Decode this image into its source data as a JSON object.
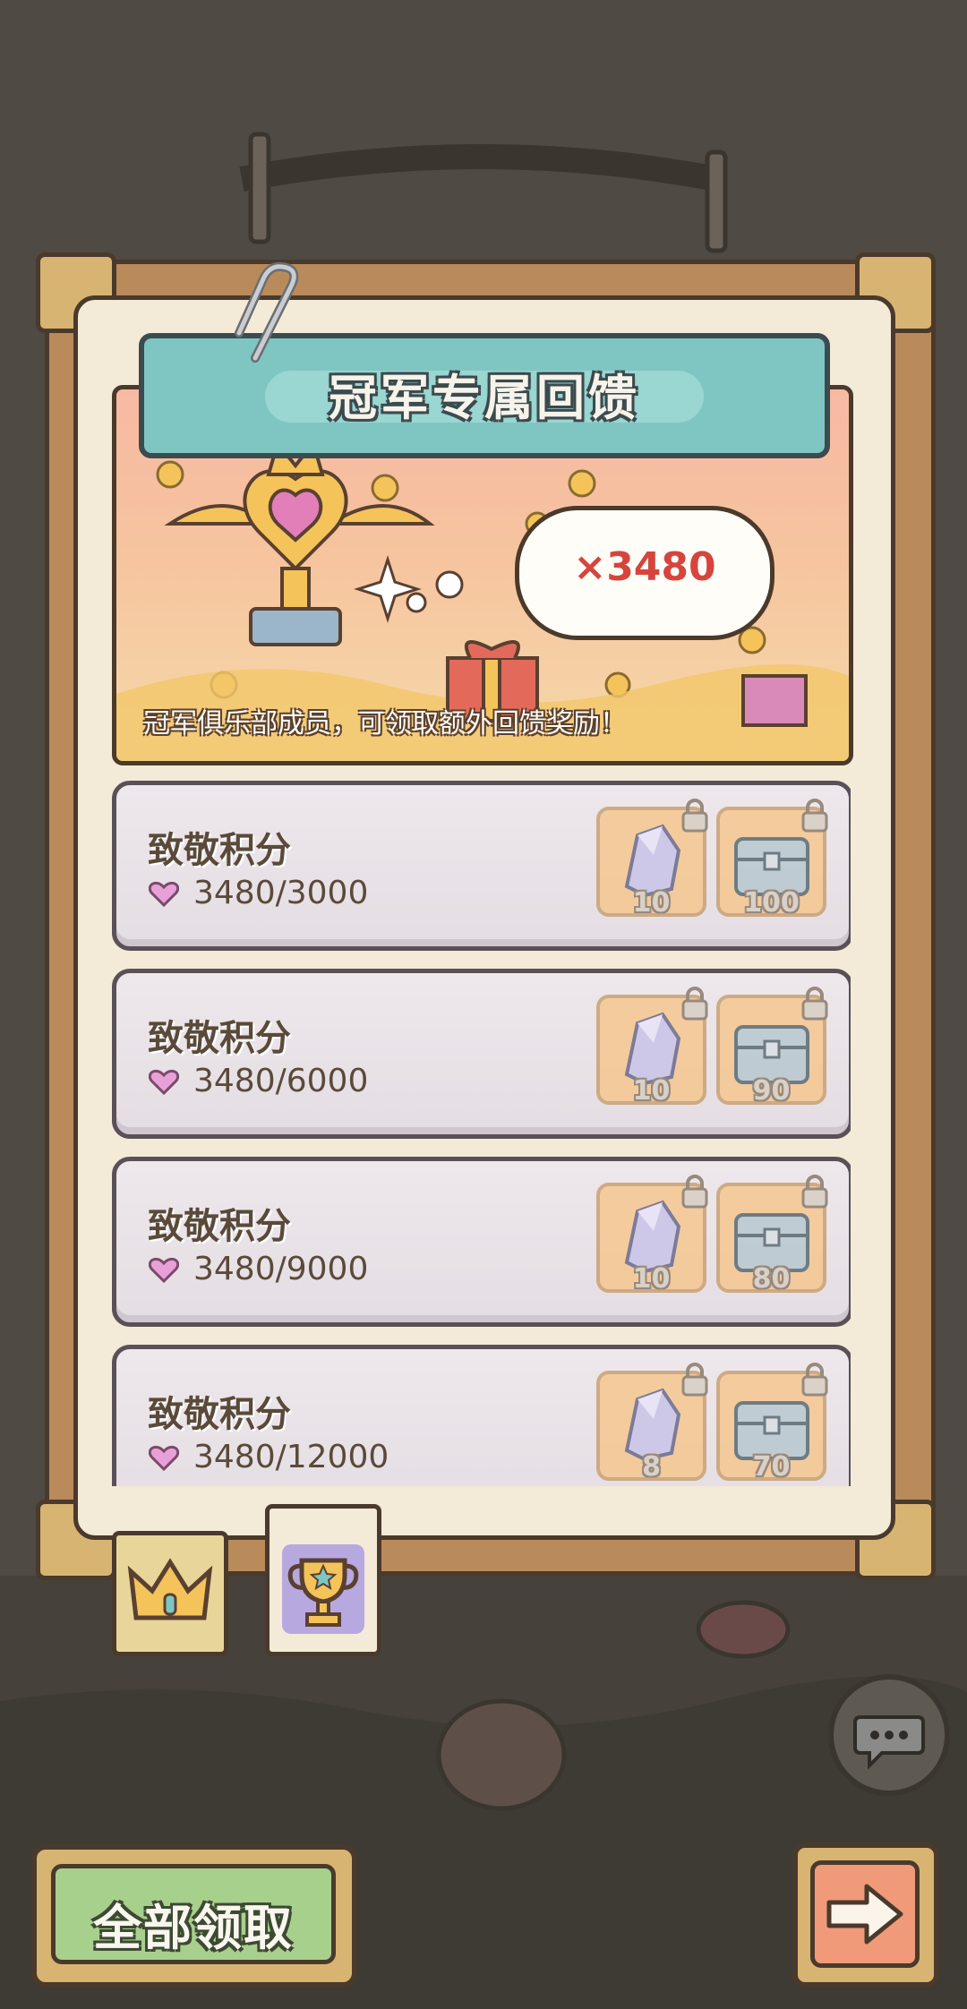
{
  "panel": {
    "title": "冠军专属回馈",
    "banner_multiplier": "×3480",
    "banner_text": "冠军俱乐部成员，可领取额外回馈奖励！"
  },
  "rows": [
    {
      "title": "致敬积分",
      "progress": "3480/3000",
      "rewards": [
        {
          "icon": "crystal-icon",
          "count": "10"
        },
        {
          "icon": "chest-icon",
          "count": "100"
        }
      ]
    },
    {
      "title": "致敬积分",
      "progress": "3480/6000",
      "rewards": [
        {
          "icon": "crystal-icon",
          "count": "10"
        },
        {
          "icon": "chest-icon",
          "count": "90"
        }
      ]
    },
    {
      "title": "致敬积分",
      "progress": "3480/9000",
      "rewards": [
        {
          "icon": "crystal-icon",
          "count": "10"
        },
        {
          "icon": "chest-icon",
          "count": "80"
        }
      ]
    },
    {
      "title": "致敬积分",
      "progress": "3480/12000",
      "rewards": [
        {
          "icon": "crystal-icon",
          "count": "8"
        },
        {
          "icon": "chest-icon",
          "count": "70"
        }
      ]
    }
  ],
  "tabs": [
    {
      "icon": "crown-icon",
      "selected": false
    },
    {
      "icon": "trophy-icon",
      "selected": true
    }
  ],
  "buttons": {
    "claim_all": "全部领取",
    "next_icon": "arrow-right-icon",
    "chat_icon": "chat-bubble-icon"
  },
  "colors": {
    "title_bar": "#7fc6c3",
    "claim_button": "#a8d08d",
    "next_button": "#f09a7a",
    "multiplier_text": "#d6453d"
  }
}
